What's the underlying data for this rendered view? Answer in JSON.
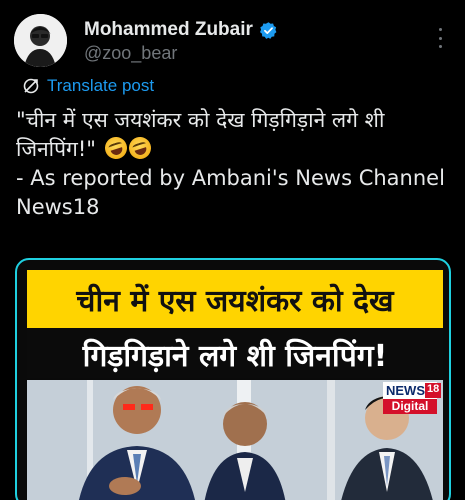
{
  "author": {
    "display_name": "Mohammed Zubair",
    "handle": "@zoo_bear",
    "verified": true
  },
  "translate": {
    "label": "Translate post",
    "icon": "translate-icon"
  },
  "post": {
    "line1": "\"चीन में एस जयशंकर को देख गिड़गिड़ाने लगे शी जिनपिंग!\"",
    "emojis": [
      "rolling-on-floor-laughing",
      "rolling-on-floor-laughing"
    ],
    "line2": "- As reported by Ambani's News Channel News18"
  },
  "media": {
    "headline_top": "चीन में एस जयशंकर को देख",
    "headline_bottom": "गिड़गिड़ाने लगे शी जिनपिंग!",
    "logo_top": "NEWS",
    "logo_num": "18",
    "logo_bottom": "Digital"
  },
  "colors": {
    "background": "#000000",
    "link": "#1d9bf0",
    "verified": "#1d9bf0",
    "banner_yellow": "#ffd400",
    "media_border": "#1fd0e0"
  }
}
